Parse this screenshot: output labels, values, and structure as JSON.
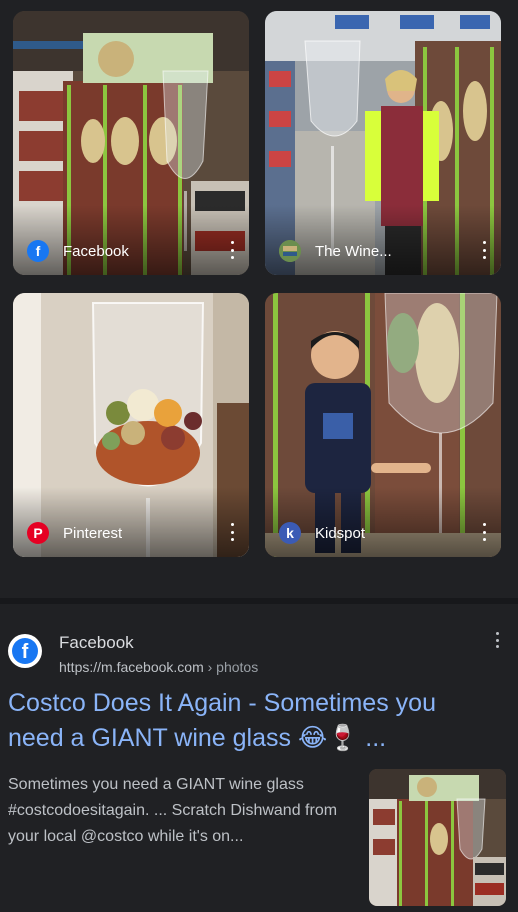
{
  "image_results": [
    {
      "source": "Facebook",
      "source_icon": "facebook-icon",
      "icon_letter": "f",
      "icon_color": "#1877f2"
    },
    {
      "source": "The Wine...",
      "source_icon": "wine-site-icon",
      "icon_letter": "",
      "icon_color": "#6b8e4e"
    },
    {
      "source": "Pinterest",
      "source_icon": "pinterest-icon",
      "icon_letter": "P",
      "icon_color": "#e60023"
    },
    {
      "source": "Kidspot",
      "source_icon": "kidspot-icon",
      "icon_letter": "k",
      "icon_color": "#3b5bb5"
    }
  ],
  "result": {
    "site_name": "Facebook",
    "url_domain": "https://m.facebook.com",
    "url_path": " › photos",
    "title": "Costco Does It Again - Sometimes you need a GIANT wine glass 😂🍷 ...",
    "snippet": "Sometimes you need a GIANT wine glass #costcodoesitagain. ... Scratch Dishwand from your local @costco while it's on...",
    "favicon_letter": "f"
  },
  "colors": {
    "background": "#202124",
    "link": "#8ab4f8",
    "text": "#bdc1c6"
  }
}
